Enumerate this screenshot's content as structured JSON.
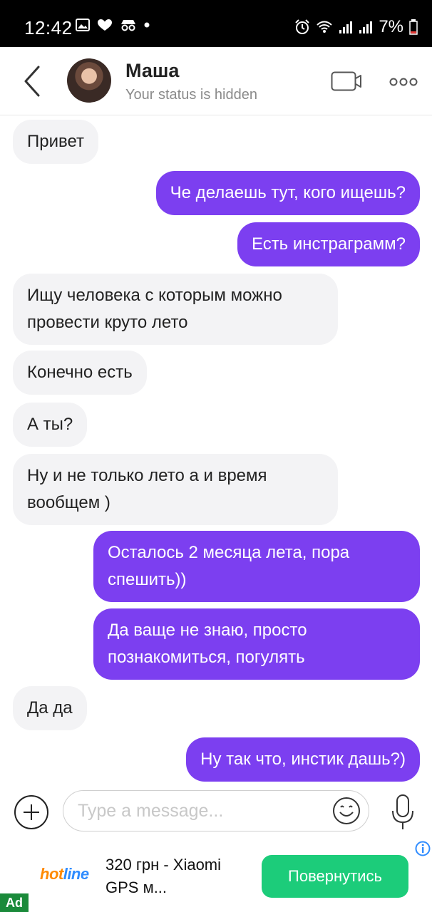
{
  "status_bar": {
    "time": "12:42",
    "battery": "7%",
    "icons": [
      "gallery-icon",
      "heart-icon",
      "incognito-icon",
      "dot-icon",
      "alarm-icon",
      "wifi-icon",
      "signal-icon",
      "signal-icon",
      "battery-icon"
    ]
  },
  "header": {
    "name": "Маша",
    "status": "Your status is hidden"
  },
  "messages": [
    {
      "dir": "in",
      "text": "Привет"
    },
    {
      "dir": "out",
      "text": "Че делаешь тут, кого ищешь?"
    },
    {
      "dir": "out",
      "text": "Есть инстраграмм?"
    },
    {
      "dir": "in",
      "text": "Ищу человека с которым можно провести круто лето"
    },
    {
      "dir": "in",
      "text": "Конечно есть"
    },
    {
      "dir": "in",
      "text": "А ты?"
    },
    {
      "dir": "in",
      "text": "Ну и не только лето а и время вообщем )"
    },
    {
      "dir": "out",
      "text": "Осталось 2 месяца лета, пора спешить))"
    },
    {
      "dir": "out",
      "text": "Да ваще не знаю, просто познакомиться, погулять"
    },
    {
      "dir": "in",
      "text": "Да да"
    },
    {
      "dir": "out",
      "text": "Ну так что, инстик дашь?)"
    }
  ],
  "composer": {
    "placeholder": "Type a message..."
  },
  "ad": {
    "logo_hot": "hot",
    "logo_line": "line",
    "text": "320 грн - Xiaomi GPS м...",
    "cta": "Повернутись",
    "badge": "Ad"
  },
  "colors": {
    "accent": "#7c3ff0",
    "incoming_bg": "#f3f3f5",
    "cta": "#1ccc7a"
  }
}
